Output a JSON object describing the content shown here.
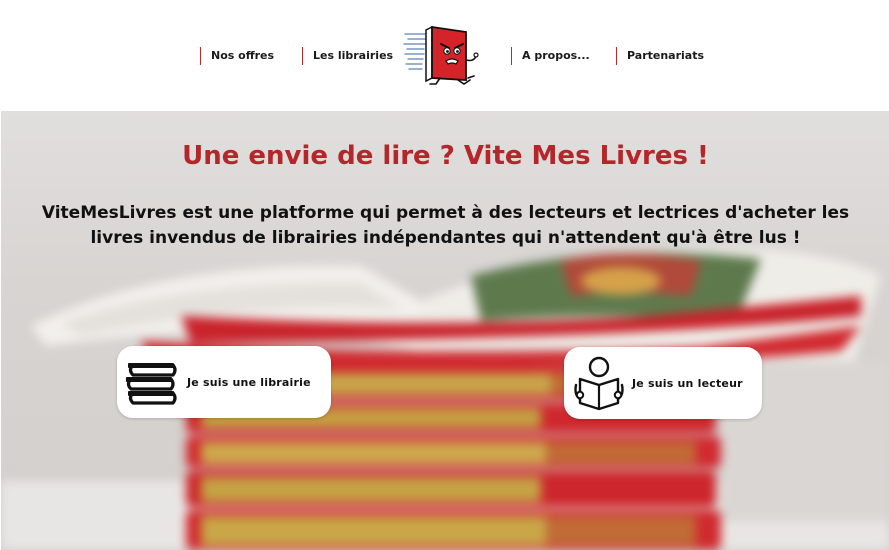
{
  "nav": {
    "items": [
      {
        "label": "Nos offres"
      },
      {
        "label": "Les librairies"
      },
      {
        "label": "A propos..."
      },
      {
        "label": "Partenariats"
      }
    ]
  },
  "hero": {
    "title": "Une envie de lire ? Vite Mes Livres !",
    "text": "ViteMesLivres est une platforme qui permet à des lecteurs et lectrices d'acheter les livres invendus de librairies indépendantes qui n'attendent qu'à être lus !"
  },
  "cta": {
    "librairie": {
      "label": "Je suis une librairie",
      "icon": "books-stack-icon"
    },
    "lecteur": {
      "label": "Je suis un lecteur",
      "icon": "reader-icon"
    }
  },
  "colors": {
    "accent": "#b3262a",
    "nav_divider": "#c0282d",
    "book_red": "#d4242a",
    "book_gold": "#c9a843"
  }
}
